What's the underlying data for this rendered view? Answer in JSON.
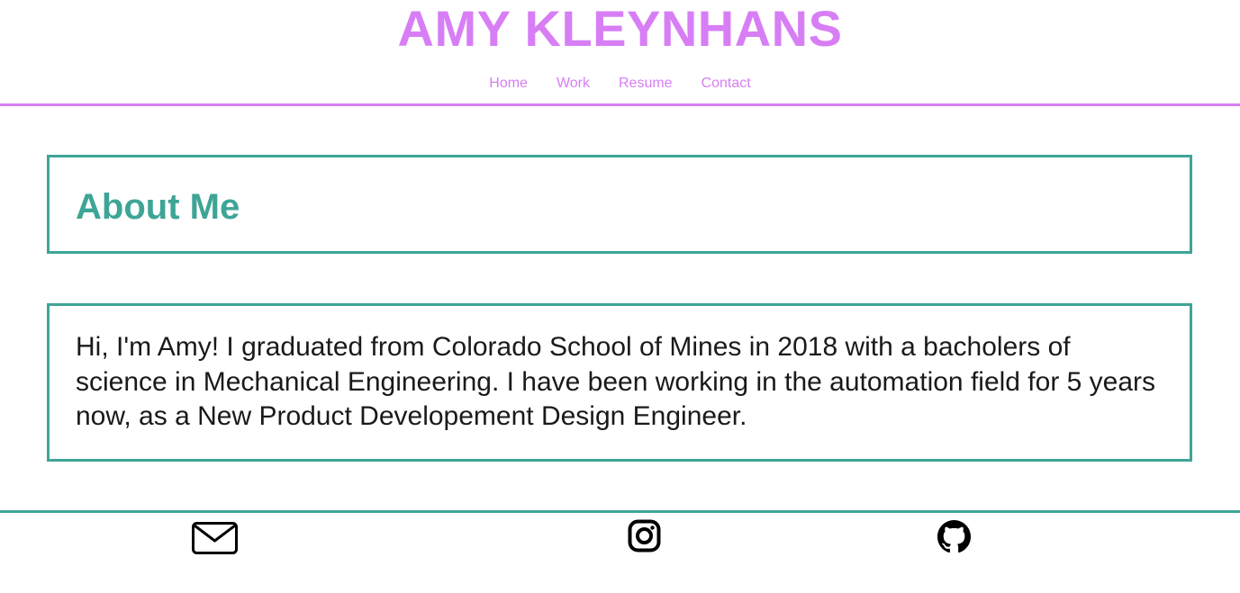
{
  "header": {
    "title": "AMY KLEYNHANS",
    "nav": [
      {
        "label": "Home"
      },
      {
        "label": "Work"
      },
      {
        "label": "Resume"
      },
      {
        "label": "Contact"
      }
    ]
  },
  "main": {
    "heading": "About Me",
    "body": "Hi, I'm Amy! I graduated from Colorado School of Mines in 2018 with a bacholers of science in Mechanical Engineering. I have been working in the automation field for 5 years now, as a New Product Developement Design Engineer."
  },
  "footer": {
    "links": [
      {
        "icon": "email-icon"
      },
      {
        "icon": "instagram-icon"
      },
      {
        "icon": "github-icon"
      }
    ]
  },
  "colors": {
    "accent_purple": "#d77ef5",
    "accent_teal": "#3ea596",
    "text": "#1a1a1a"
  }
}
